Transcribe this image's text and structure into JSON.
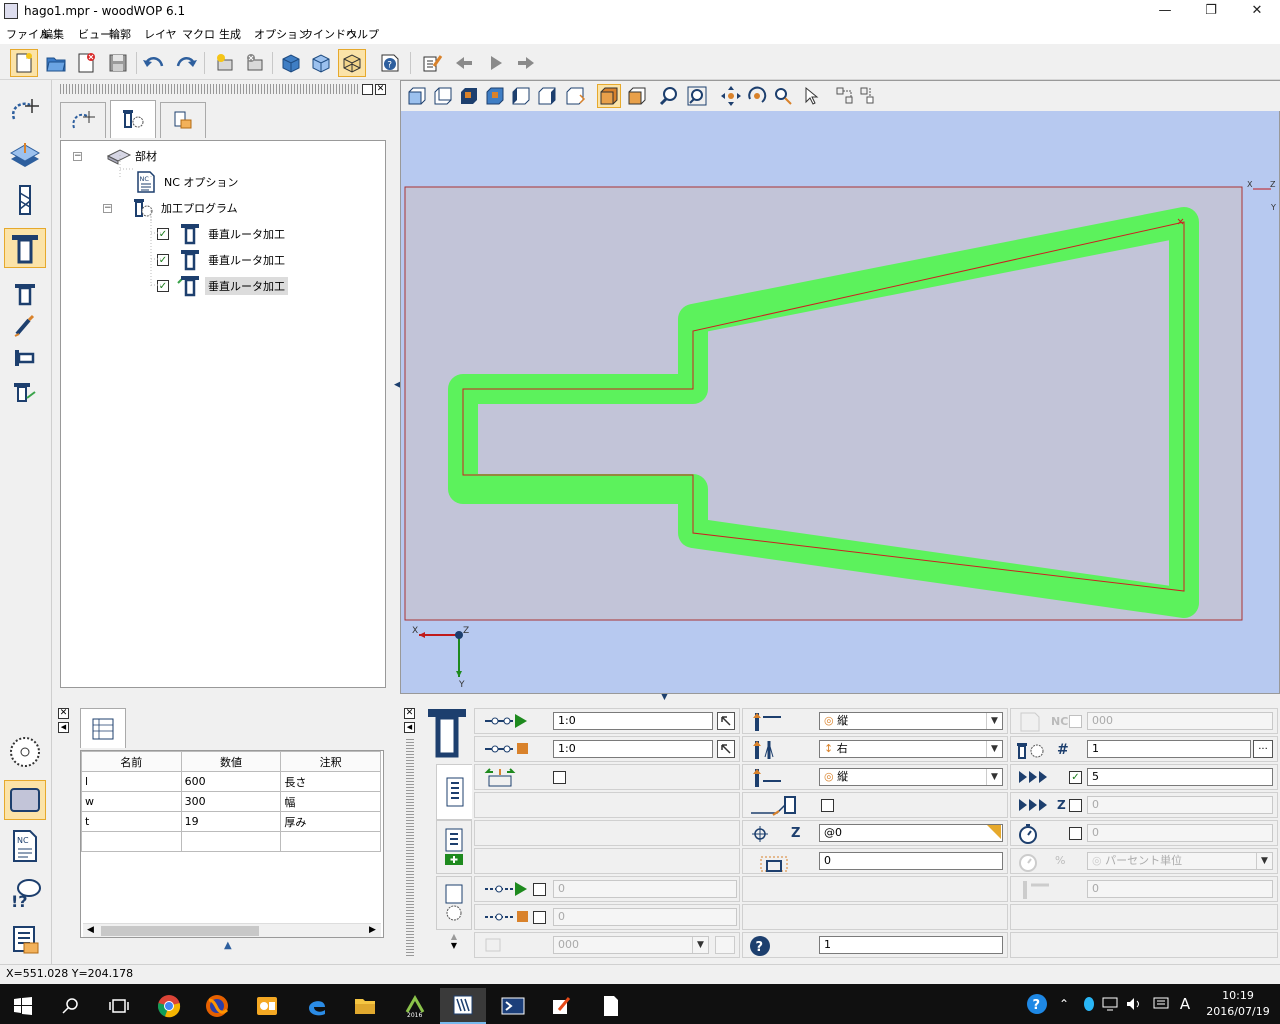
{
  "window": {
    "title": "hago1.mpr - woodWOP 6.1",
    "minimize": "—",
    "restore": "❐",
    "close": "✕"
  },
  "menu": [
    "ファイル",
    "編集",
    "ビュー",
    "輪郭",
    "レイヤ",
    "マクロ",
    "生成",
    "オプション",
    "ウインドウ",
    "ヘルプ"
  ],
  "tree": {
    "root": "部材",
    "nc_option": "NC オプション",
    "program": "加工プログラム",
    "items": [
      {
        "label": "垂直ルータ加工",
        "checked": true,
        "selected": false
      },
      {
        "label": "垂直ルータ加工",
        "checked": true,
        "selected": false
      },
      {
        "label": "垂直ルータ加工",
        "checked": true,
        "selected": true
      }
    ]
  },
  "variables": {
    "headers": [
      "名前",
      "数値",
      "注釈"
    ],
    "rows": [
      [
        "l",
        "600",
        "長さ"
      ],
      [
        "w",
        "300",
        "幅"
      ],
      [
        "t",
        "19",
        "厚み"
      ],
      [
        "",
        "",
        ""
      ]
    ]
  },
  "props": {
    "col1": {
      "start_value": "1:0",
      "end_value": "1:0"
    },
    "col2": {
      "approach_mode": "縦",
      "radius_comp": "右",
      "retract_mode": "縦",
      "z_value": "@0",
      "offset_value": "0",
      "help_value": "1"
    },
    "col3": {
      "nc_label": "NC",
      "nc_value": "000",
      "hash_value": "1",
      "feed_value": "5",
      "z_feed_value": "0",
      "time_value": "0",
      "percent_label": "%",
      "percent_unit": "パーセント単位",
      "extra_value": "0"
    },
    "bottom": {
      "disabled_a": "0",
      "disabled_b": "0",
      "tool_value": "000"
    }
  },
  "status": {
    "coords": "X=551.028 Y=204.178"
  },
  "taskbar": {
    "time": "10:19",
    "date": "2016/07/19",
    "ime": "A"
  },
  "viewport": {
    "axis_x": "X",
    "axis_y": "Y",
    "axis_z": "Z",
    "corner_x": "X",
    "corner_y": "Y",
    "corner_z": "Z"
  },
  "colors": {
    "workpiece": "#c2c4d8",
    "background": "#b7c9f0",
    "toolpath": "#5cf25c",
    "contour": "#cc2020",
    "accent": "#e6a92c"
  }
}
